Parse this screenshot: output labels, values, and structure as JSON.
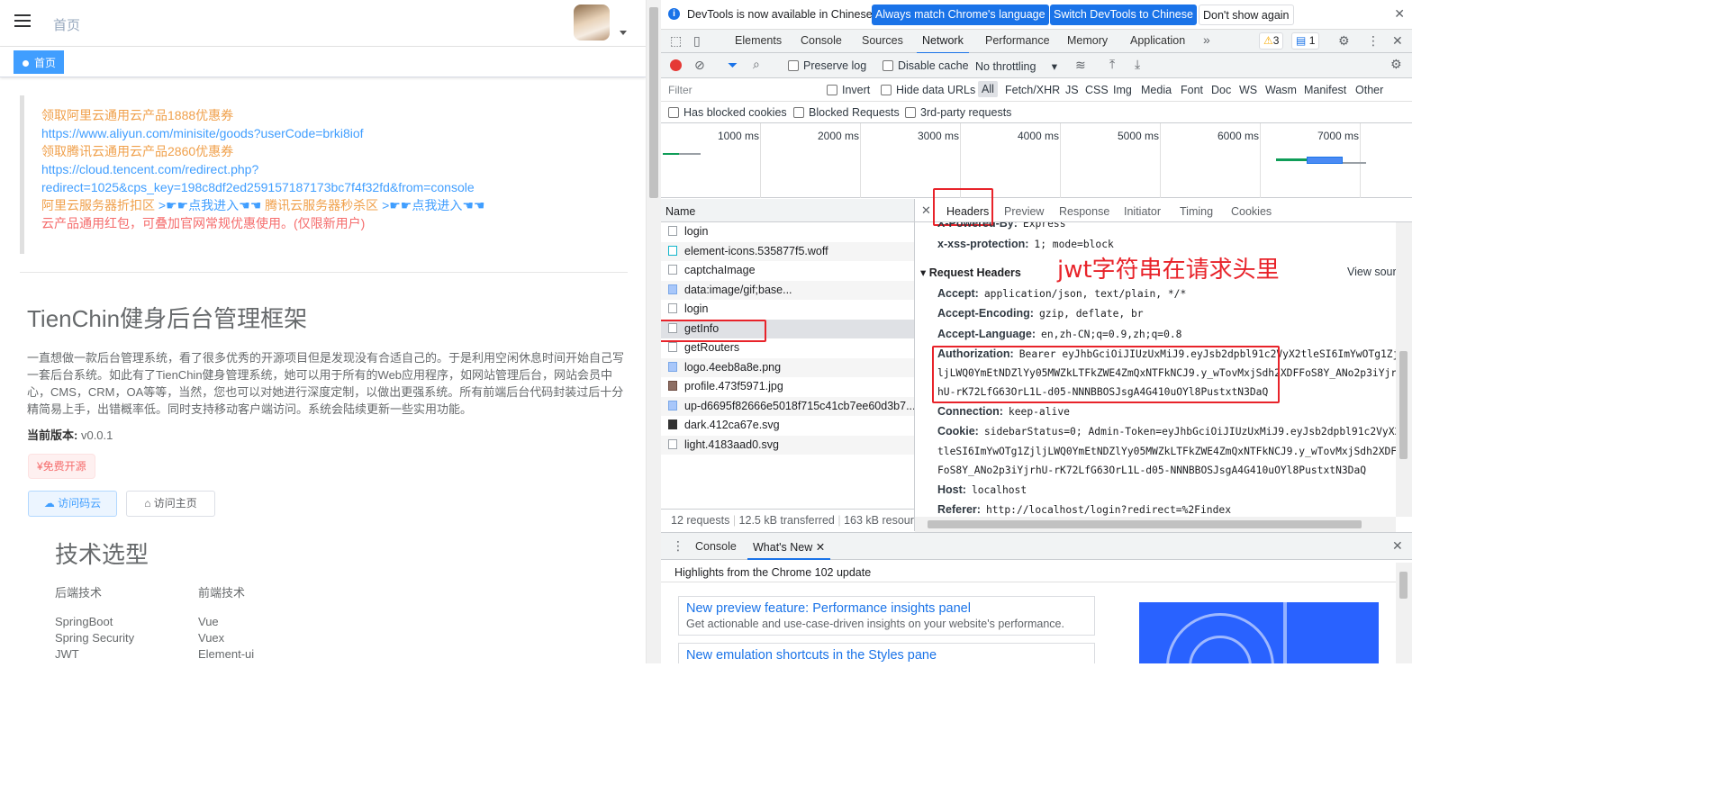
{
  "app": {
    "breadcrumb": "首页",
    "tag": "首页",
    "notice": {
      "line1": "领取阿里云通用云产品1888优惠券",
      "line2": "https://www.aliyun.com/minisite/goods?userCode=brki8iof",
      "line3": "领取腾讯云通用云产品2860优惠券",
      "line4": "https://cloud.tencent.com/redirect.php?",
      "line5": "redirect=1025&cps_key=198c8df2ed259157187173bc7f4f32fd&from=console",
      "line6a": "阿里云服务器折扣区",
      "line6b": ">☛☛点我进入☚☚",
      "line6c": "腾讯云服务器秒杀区",
      "line6d": ">☛☛点我进入☚☚",
      "line7": "云产品通用红包，可叠加官网常规优惠使用。(仅限新用户)"
    },
    "title": "TienChin健身后台管理框架",
    "intro": "一直想做一款后台管理系统，看了很多优秀的开源项目但是发现没有合适自己的。于是利用空闲休息时间开始自己写一套后台系统。如此有了TienChin健身管理系统，她可以用于所有的Web应用程序，如网站管理后台，网站会员中心，CMS，CRM，OA等等，当然，您也可以对她进行深度定制，以做出更强系统。所有前端后台代码封装过后十分精简易上手，出错概率低。同时支持移动客户端访问。系统会陆续更新一些实用功能。",
    "version_label": "当前版本:",
    "version_value": "v0.0.1",
    "free_tag": "¥免费开源",
    "btn_gitee": "访问码云",
    "btn_home": "访问主页",
    "tech_title": "技术选型",
    "backend_label": "后端技术",
    "frontend_label": "前端技术",
    "backend": [
      "SpringBoot",
      "Spring Security",
      "JWT"
    ],
    "frontend": [
      "Vue",
      "Vuex",
      "Element-ui"
    ]
  },
  "devtools": {
    "banner": {
      "message": "DevTools is now available in Chinese!",
      "btn_match": "Always match Chrome's language",
      "btn_switch": "Switch DevTools to Chinese",
      "btn_dismiss": "Don't show again"
    },
    "tabs": [
      "Elements",
      "Console",
      "Sources",
      "Network",
      "Performance",
      "Memory",
      "Application"
    ],
    "active_tab": "Network",
    "warn_count": "3",
    "msg_count": "1",
    "toolbar": {
      "preserve_log": "Preserve log",
      "disable_cache": "Disable cache",
      "throttling": "No throttling"
    },
    "filter": {
      "placeholder": "Filter",
      "invert": "Invert",
      "hide_data_urls": "Hide data URLs",
      "types": [
        "All",
        "Fetch/XHR",
        "JS",
        "CSS",
        "Img",
        "Media",
        "Font",
        "Doc",
        "WS",
        "Wasm",
        "Manifest",
        "Other"
      ],
      "blocked_cookies": "Has blocked cookies",
      "blocked_requests": "Blocked Requests",
      "third_party": "3rd-party requests"
    },
    "timeline": [
      "1000 ms",
      "2000 ms",
      "3000 ms",
      "4000 ms",
      "5000 ms",
      "6000 ms",
      "7000 ms"
    ],
    "name_header": "Name",
    "requests": [
      {
        "name": "login",
        "kind": "doc"
      },
      {
        "name": "element-icons.535877f5.woff",
        "kind": "font"
      },
      {
        "name": "captchaImage",
        "kind": "doc"
      },
      {
        "name": "data:image/gif;base...",
        "kind": "img"
      },
      {
        "name": "login",
        "kind": "doc"
      },
      {
        "name": "getInfo",
        "kind": "doc"
      },
      {
        "name": "getRouters",
        "kind": "doc"
      },
      {
        "name": "logo.4eeb8a8e.png",
        "kind": "img"
      },
      {
        "name": "profile.473f5971.jpg",
        "kind": "img"
      },
      {
        "name": "up-d6695f82666e5018f715c41cb7ee60d3b7...",
        "kind": "img"
      },
      {
        "name": "dark.412ca67e.svg",
        "kind": "img"
      },
      {
        "name": "light.4183aad0.svg",
        "kind": "img"
      }
    ],
    "status": {
      "requests": "12 requests",
      "transferred": "12.5 kB transferred",
      "resources": "163 kB resources"
    },
    "detail_tabs": [
      "Headers",
      "Preview",
      "Response",
      "Initiator",
      "Timing",
      "Cookies"
    ],
    "headers": {
      "powered_by_key": "X-Powered-By:",
      "powered_by_val": "Express",
      "xss_key": "x-xss-protection:",
      "xss_val": "1; mode=block",
      "section": "▾ Request Headers",
      "view_source": "View source",
      "accept_key": "Accept:",
      "accept_val": "application/json, text/plain, */*",
      "enc_key": "Accept-Encoding:",
      "enc_val": "gzip, deflate, br",
      "lang_key": "Accept-Language:",
      "lang_val": "en,zh-CN;q=0.9,zh;q=0.8",
      "auth_key": "Authorization:",
      "auth_l1": "Bearer eyJhbGciOiJIUzUxMiJ9.eyJsb2dpbl91c2VyX2tleSI6ImYwOTg1Zj",
      "auth_l2": "ljLWQ0YmEtNDZlYy05MWZkLTFkZWE4ZmQxNTFkNCJ9.y_wTovMxjSdh2XDFFoS8Y_ANo2p3iYjr",
      "auth_l3": "hU-rK72LfG63OrL1L-d05-NNNBBOSJsgA4G410uOYl8PustxtN3DaQ",
      "conn_key": "Connection:",
      "conn_val": "keep-alive",
      "cookie_key": "Cookie:",
      "cookie_l1": "sidebarStatus=0; Admin-Token=eyJhbGciOiJIUzUxMiJ9.eyJsb2dpbl91c2VyX2",
      "cookie_l2": "tleSI6ImYwOTg1ZjljLWQ0YmEtNDZlYy05MWZkLTFkZWE4ZmQxNTFkNCJ9.y_wTovMxjSdh2XDF",
      "cookie_l3": "FoS8Y_ANo2p3iYjrhU-rK72LfG63OrL1L-d05-NNNBBOSJsgA4G410uOYl8PustxtN3DaQ",
      "host_key": "Host:",
      "host_val": "localhost",
      "ref_key": "Referer:",
      "ref_val": "http://localhost/login?redirect=%2Findex"
    },
    "annotation": "jwt字符串在请求头里",
    "drawer": {
      "tab_console": "Console",
      "tab_whatsnew": "What's New",
      "highlights": "Highlights from the Chrome 102 update",
      "card1_title": "New preview feature: Performance insights panel",
      "card1_desc": "Get actionable and use-case-driven insights on your website's performance.",
      "card2_title": "New emulation shortcuts in the Styles pane"
    }
  }
}
